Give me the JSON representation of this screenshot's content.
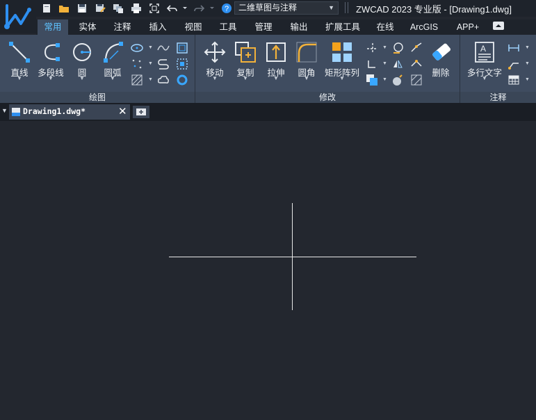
{
  "app": {
    "title": "ZWCAD 2023 专业版 - [Drawing1.dwg]",
    "workspace": "二维草图与注释"
  },
  "ribbon_tabs": [
    "常用",
    "实体",
    "注释",
    "插入",
    "视图",
    "工具",
    "管理",
    "输出",
    "扩展工具",
    "在线",
    "ArcGIS",
    "APP+"
  ],
  "active_tab": "常用",
  "groups": {
    "draw": {
      "label": "绘图",
      "buttons": [
        "直线",
        "多段线",
        "圆",
        "圆弧"
      ]
    },
    "modify": {
      "label": "修改",
      "buttons": [
        "移动",
        "复制",
        "拉伸",
        "圆角",
        "矩形阵列",
        "删除"
      ]
    },
    "annotate": {
      "label": "注释",
      "buttons": [
        "多行文字"
      ]
    }
  },
  "document_tab": {
    "name": "Drawing1.dwg*"
  },
  "colors": {
    "ribbon": "#3f4c60",
    "canvas": "#23272f",
    "accent": "#5fc3ff"
  }
}
